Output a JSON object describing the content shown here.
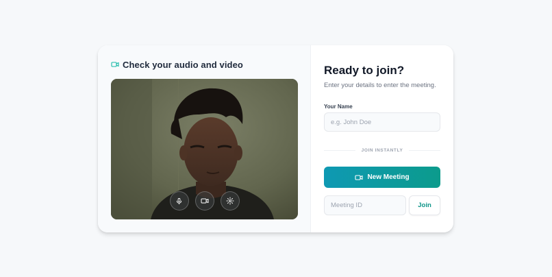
{
  "preview": {
    "title": "Check your audio and video",
    "header_icon": "video-camera-icon",
    "controls": [
      {
        "name": "microphone-icon"
      },
      {
        "name": "video-camera-icon"
      },
      {
        "name": "settings-gear-icon"
      }
    ]
  },
  "join_panel": {
    "title": "Ready to join?",
    "subtitle": "Enter your details to enter the meeting.",
    "name_label": "Your Name",
    "name_placeholder": "e.g. John Doe",
    "name_value": "",
    "divider_text": "JOIN INSTANTLY",
    "new_meeting_label": "New Meeting",
    "meeting_id_placeholder": "Meeting ID",
    "meeting_id_value": "",
    "join_label": "Join"
  },
  "colors": {
    "accent_teal": "#0d9488",
    "accent_gradient_start": "#0e99b3",
    "accent_gradient_end": "#0c9b8c",
    "page_background": "#f6f8fa"
  }
}
